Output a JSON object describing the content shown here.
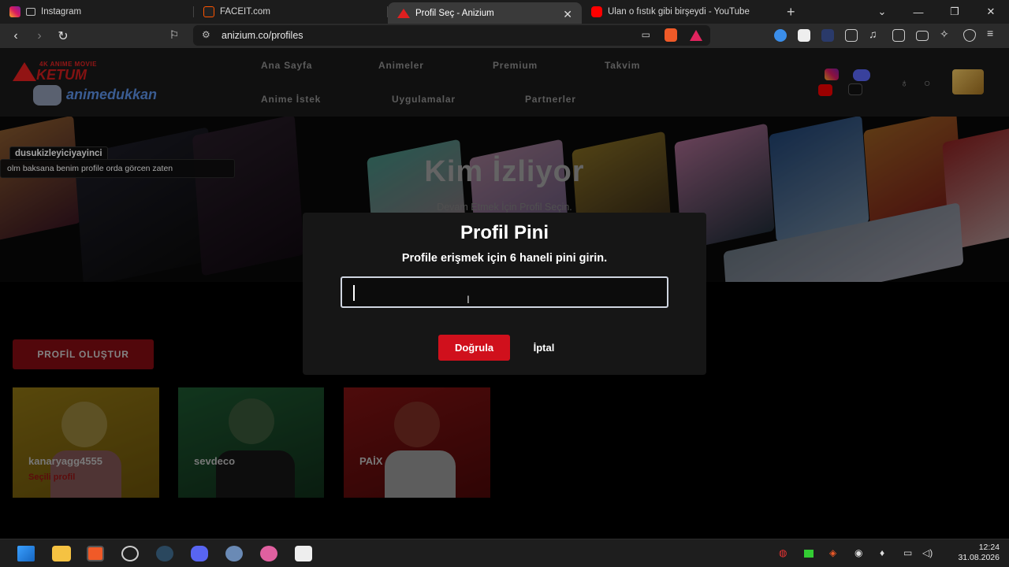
{
  "browser": {
    "tabs": [
      {
        "label": "Instagram",
        "active": false
      },
      {
        "label": "FACEIT.com",
        "active": false
      },
      {
        "label": "Profil Seç - Anizium",
        "active": true
      },
      {
        "label": "Ulan o fıstık gibi birşeydi - YouTube",
        "active": false
      }
    ],
    "url": "anizium.co/profiles",
    "new_tab_label": "+",
    "close_tab_label": "✕"
  },
  "site": {
    "logo_top_small": "4K ANIME MOVIE",
    "logo_top": "KETUM",
    "logo_bottom": "animedukkan",
    "nav": [
      "Ana Sayfa",
      "Animeler",
      "Premium",
      "Takvim",
      "Anime İstek",
      "Uygulamalar",
      "Partnerler"
    ]
  },
  "hero": {
    "title": "Kim İzliyor",
    "subtitle": "Devam Etmek İçin Profil Seçin."
  },
  "chat_overlay": {
    "username": "dusukizleyiciyayinci",
    "message": "olm baksana benim profile orda görcen zaten"
  },
  "modal": {
    "title": "Profil Pini",
    "subtitle": "Profile erişmek için 6 haneli pini girin.",
    "pin_value": "",
    "verify_label": "Doğrula",
    "cancel_label": "İptal"
  },
  "create_profile_label": "PROFİL OLUŞTUR",
  "profiles": [
    {
      "name": "kanaryagg4555",
      "status": "Seçili profil",
      "color": "#c9a415"
    },
    {
      "name": "sevdeco",
      "status": "",
      "color": "#2e7a45"
    },
    {
      "name": "PAİX",
      "status": "",
      "color": "#b01616"
    }
  ],
  "taskbar": {
    "time": "12:24",
    "date": "31.08.2026"
  },
  "colors": {
    "accent": "#d0101c",
    "modal_bg": "#161616"
  }
}
